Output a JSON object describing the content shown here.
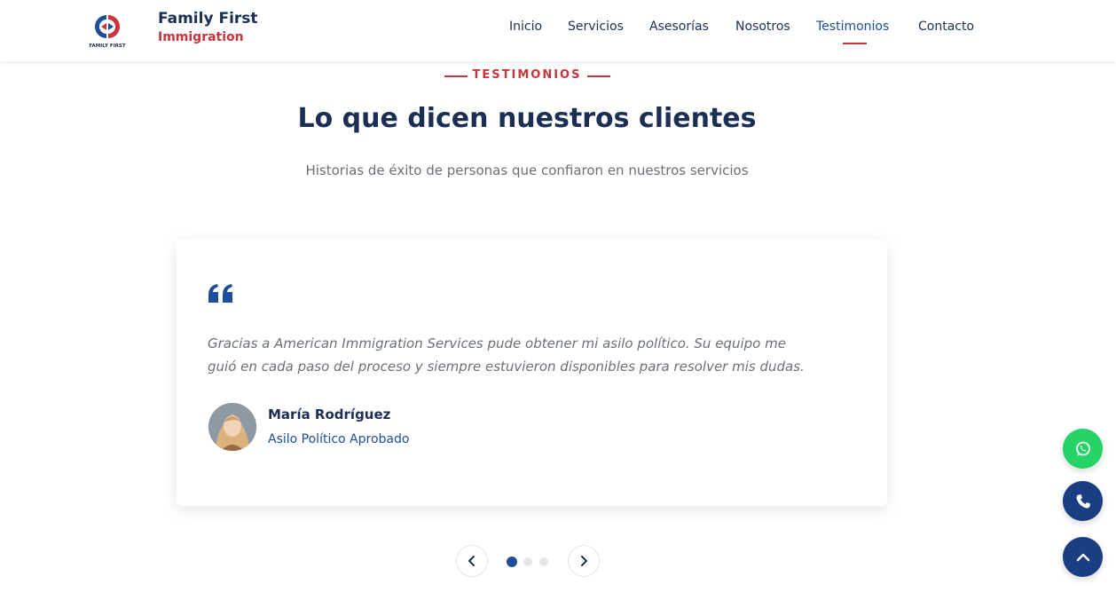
{
  "colors": {
    "navy": "#1b2f55",
    "blue": "#1e4d9c",
    "red": "#c8343b",
    "whatsapp_green": "#25d366"
  },
  "header": {
    "logo_caption": "FAMILY FIRST",
    "brand_name": "Family First",
    "brand_sub": "Immigration",
    "nav": [
      {
        "label": "Inicio"
      },
      {
        "label": "Servicios"
      },
      {
        "label": "Asesorías"
      },
      {
        "label": "Nosotros"
      },
      {
        "label": "Testimonios",
        "active": true
      },
      {
        "label": "Contacto"
      }
    ]
  },
  "section": {
    "eyebrow": "TESTIMONIOS",
    "title": "Lo que dicen nuestros clientes",
    "subtitle": "Historias de éxito de personas que confiaron en nuestros servicios"
  },
  "testimonial": {
    "quote_icon": "quote-icon",
    "quote_lines": [
      "Gracias a American Immigration Services pude obtener mi asilo político. Su equipo me",
      "guió en cada paso del proceso y siempre estuvieron disponibles para resolver mis dudas."
    ],
    "author_name": "María Rodríguez",
    "author_role": "Asilo Político Aprobado"
  },
  "carousel": {
    "prev_icon": "chevron-left-icon",
    "next_icon": "chevron-right-icon",
    "slide_count": 3,
    "active_index": 0
  },
  "floating": {
    "whatsapp_icon": "whatsapp-icon",
    "phone_icon": "phone-icon",
    "back_to_top_icon": "chevron-up-icon"
  }
}
